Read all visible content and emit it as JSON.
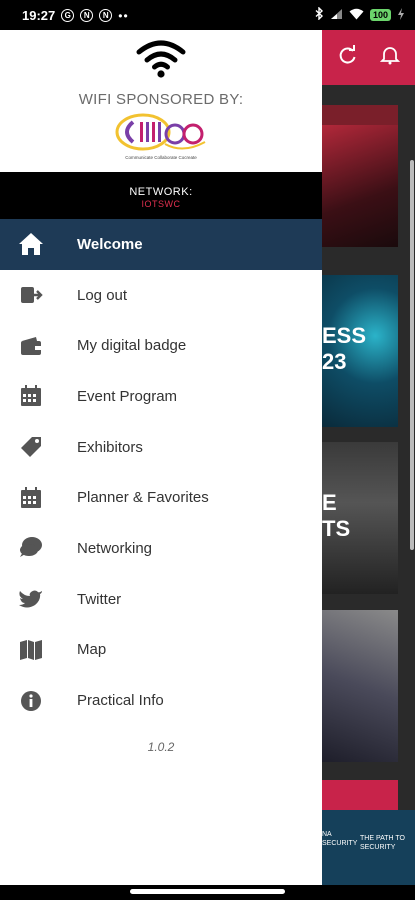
{
  "status_bar": {
    "time": "19:27",
    "indicators": [
      "G",
      "N",
      "N"
    ],
    "battery": "100"
  },
  "drawer": {
    "sponsor_title": "WIFI SPONSORED BY:",
    "logo_tagline": "Communicate  Collaborate  Cocreate",
    "network_label": "NETWORK:",
    "network_value": "IOTSWC",
    "menu": [
      {
        "label": "Welcome",
        "icon": "home-icon",
        "active": true
      },
      {
        "label": "Log out",
        "icon": "logout-icon",
        "active": false
      },
      {
        "label": "My digital badge",
        "icon": "wallet-icon",
        "active": false
      },
      {
        "label": "Event Program",
        "icon": "calendar-icon",
        "active": false
      },
      {
        "label": "Exhibitors",
        "icon": "tag-icon",
        "active": false
      },
      {
        "label": "Planner & Favorites",
        "icon": "calendar-star-icon",
        "active": false
      },
      {
        "label": "Networking",
        "icon": "chat-icon",
        "active": false
      },
      {
        "label": "Twitter",
        "icon": "twitter-icon",
        "active": false
      },
      {
        "label": "Map",
        "icon": "map-icon",
        "active": false
      },
      {
        "label": "Practical Info",
        "icon": "info-icon",
        "active": false
      }
    ],
    "version": "1.0.2"
  },
  "background": {
    "card_text_1": "ESS",
    "card_text_2": "23",
    "card_text_3": "E",
    "card_text_4": "TS",
    "footer_text_1": "NA SECURITY",
    "footer_text_2": "THE PATH TO SECURITY"
  },
  "colors": {
    "header": "#c8234a",
    "active_item": "#1e3a56",
    "network_value": "#e0304f"
  }
}
